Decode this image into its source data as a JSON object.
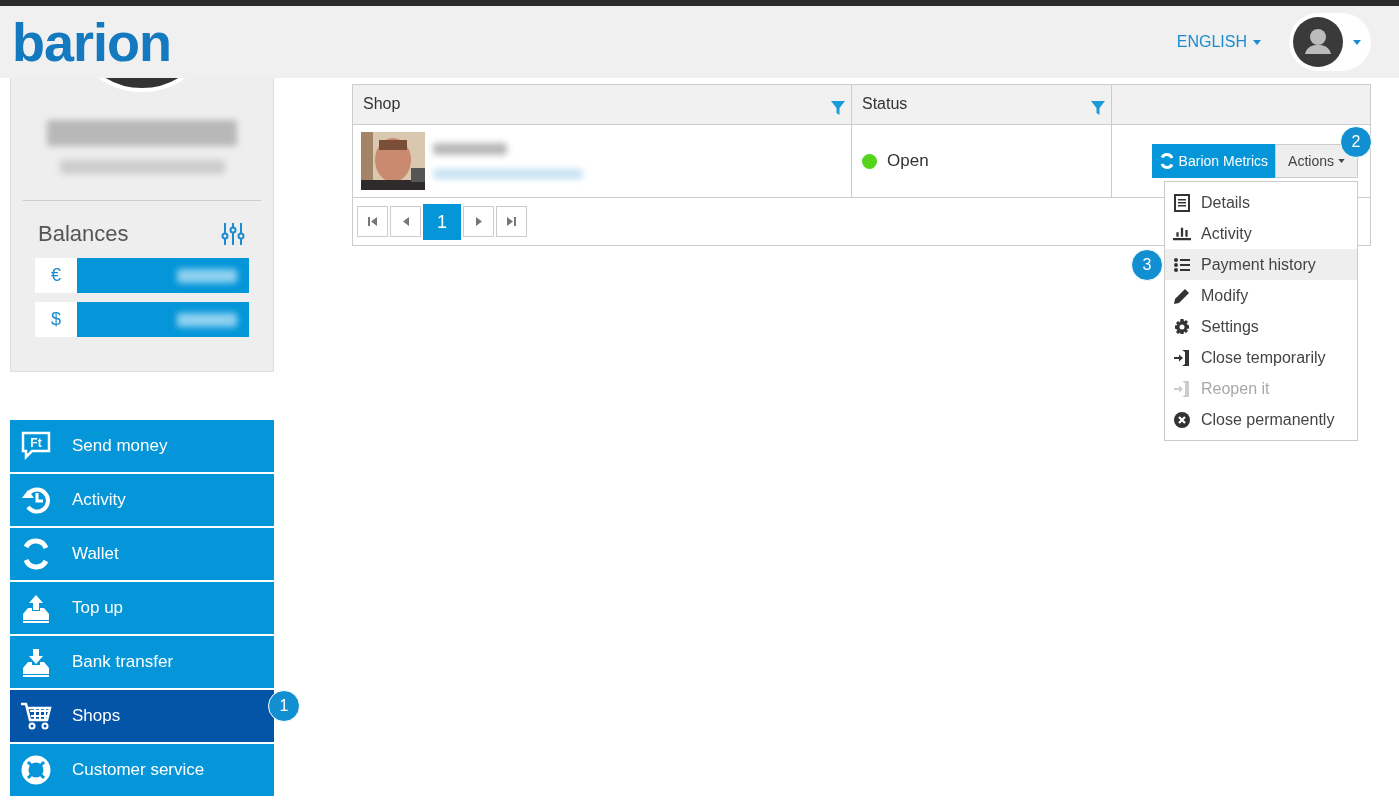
{
  "header": {
    "logo": "barion",
    "language": "ENGLISH"
  },
  "balances": {
    "title": "Balances",
    "currencies": [
      {
        "symbol": "€"
      },
      {
        "symbol": "$"
      }
    ]
  },
  "menu": {
    "badge": "1",
    "items": [
      {
        "label": "Send money",
        "icon_text": "Ft",
        "selected": false
      },
      {
        "label": "Activity",
        "selected": false
      },
      {
        "label": "Wallet",
        "selected": false
      },
      {
        "label": "Top up",
        "selected": false
      },
      {
        "label": "Bank transfer",
        "selected": false
      },
      {
        "label": "Shops",
        "selected": true
      },
      {
        "label": "Customer service",
        "selected": false
      }
    ]
  },
  "table": {
    "columns": [
      {
        "label": "Shop"
      },
      {
        "label": "Status"
      }
    ],
    "rows": [
      {
        "status": "Open",
        "color": "#55d41c",
        "metrics_button": "Barion Metrics",
        "actions_button": "Actions",
        "badge": "2"
      }
    ],
    "pagination": [
      {
        "label": "1",
        "selected": true
      }
    ]
  },
  "actions_menu": {
    "items": [
      {
        "label": "Details",
        "disabled": false,
        "selected": false
      },
      {
        "label": "Activity",
        "disabled": false,
        "selected": false
      },
      {
        "label": "Payment history",
        "disabled": false,
        "selected": true,
        "badge": "3"
      },
      {
        "label": "Modify",
        "disabled": false,
        "selected": false
      },
      {
        "label": "Settings",
        "disabled": false,
        "selected": false
      },
      {
        "label": "Close temporarily",
        "disabled": false,
        "selected": false
      },
      {
        "label": "Reopen it",
        "disabled": true,
        "selected": false
      },
      {
        "label": "Close permanently",
        "disabled": false,
        "selected": false
      }
    ]
  }
}
